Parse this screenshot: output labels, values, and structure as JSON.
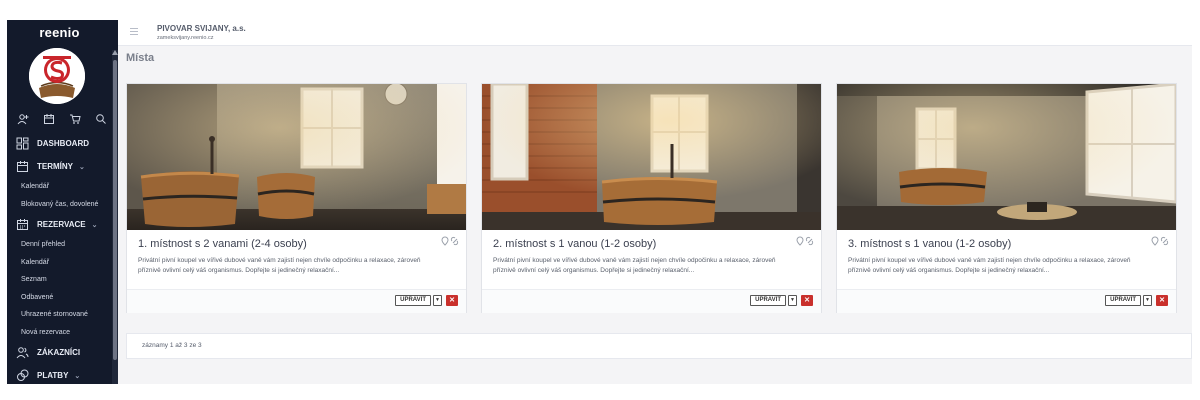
{
  "sidebar": {
    "brand": "reenio",
    "quick_icons": [
      "add-user-icon",
      "calendar-icon",
      "cart-icon",
      "search-icon"
    ],
    "items": [
      {
        "label": "DASHBOARD",
        "icon": "dashboard-icon"
      },
      {
        "label": "TERMÍNY",
        "icon": "calendar-icon",
        "expandable": true,
        "children": [
          "Kalendář",
          "Blokovaný čas, dovolené"
        ]
      },
      {
        "label": "REZERVACE",
        "icon": "calendar-icon",
        "expandable": true,
        "children": [
          "Denní přehled",
          "Kalendář",
          "Seznam",
          "Odbavené",
          "Uhrazené stornované",
          "Nová rezervace"
        ]
      },
      {
        "label": "ZÁKAZNÍCI",
        "icon": "users-icon"
      },
      {
        "label": "PLATBY",
        "icon": "coins-icon",
        "expandable": true
      }
    ]
  },
  "header": {
    "company": "PIVOVAR SVIJANY, a.s.",
    "subdomain": "zameksvijany.reenio.cz"
  },
  "page": {
    "title": "Místa"
  },
  "places": [
    {
      "name": "1. místnost s 2 vanami (2-4 osoby)",
      "description": "Privátní pivní koupel ve vířivé dubové vaně vám zajistí nejen chvíle odpočinku a relaxace, zároveň příznivě ovlivní celý váš organismus.  Dopřejte si jedinečný relaxační...",
      "edit_label": "UPRAVIT"
    },
    {
      "name": "2. místnost s 1 vanou (1-2 osoby)",
      "description": "Privátní pivní koupel ve vířivé dubové vaně vám zajistí nejen chvíle odpočinku a relaxace, zároveň příznivě ovlivní celý váš organismus.  Dopřejte si jedinečný relaxační...",
      "edit_label": "UPRAVIT"
    },
    {
      "name": "3. místnost s 1 vanou (1-2 osoby)",
      "description": "Privátní pivní koupel ve vířivé dubové vaně vám zajistí nejen chvíle odpočinku a relaxace, zároveň příznivě ovlivní celý váš organismus.  Dopřejte si jedinečný relaxační...",
      "edit_label": "UPRAVIT"
    }
  ],
  "pagination": {
    "summary": "záznamy 1 až 3 ze 3"
  },
  "colors": {
    "sidebar_bg": "#131a2b",
    "delete": "#c9302c",
    "wood": "#9a6535"
  }
}
